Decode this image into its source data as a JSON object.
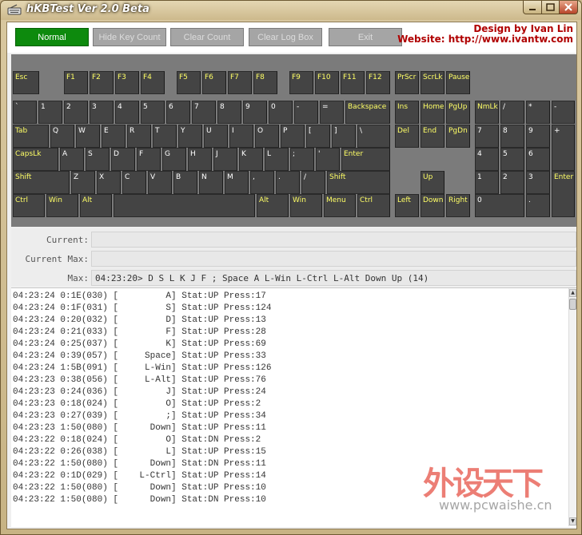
{
  "window": {
    "title": "hKBTest Ver 2.0 Beta",
    "credit_design": "Design by Ivan Lin",
    "credit_website": "Website: http://www.ivantw.com"
  },
  "toolbar": {
    "normal": "Normal",
    "hide_key_count": "Hide Key Count",
    "clear_count": "Clear Count",
    "clear_log_box": "Clear Log Box",
    "exit": "Exit"
  },
  "keyboard": {
    "esc": "Esc",
    "f1": "F1",
    "f2": "F2",
    "f3": "F3",
    "f4": "F4",
    "f5": "F5",
    "f6": "F6",
    "f7": "F7",
    "f8": "F8",
    "f9": "F9",
    "f10": "F10",
    "f11": "F11",
    "f12": "F12",
    "prscr": "PrScr",
    "scrlk": "ScrLk",
    "pause": "Pause",
    "backquote": "`",
    "k1": "1",
    "k2": "2",
    "k3": "3",
    "k4": "4",
    "k5": "5",
    "k6": "6",
    "k7": "7",
    "k8": "8",
    "k9": "9",
    "k0": "0",
    "minus": "-",
    "equal": "=",
    "backspace": "Backspace",
    "ins": "Ins",
    "home": "Home",
    "pgup": "PgUp",
    "numlk": "NmLk",
    "np_div": "/",
    "np_mul": "*",
    "np_minus": "-",
    "tab": "Tab",
    "q": "Q",
    "w": "W",
    "e": "E",
    "r": "R",
    "t": "T",
    "y": "Y",
    "u": "U",
    "i": "I",
    "o": "O",
    "p": "P",
    "lbracket": "[",
    "rbracket": "]",
    "backslash": "\\",
    "del": "Del",
    "end": "End",
    "pgdn": "PgDn",
    "np7": "7",
    "np8": "8",
    "np9": "9",
    "np_plus": "+",
    "capslk": "CapsLk",
    "a": "A",
    "s": "S",
    "d": "D",
    "f": "F",
    "g": "G",
    "h": "H",
    "j": "J",
    "k": "K",
    "l": "L",
    "semicolon": ";",
    "quote": "'",
    "enter": "Enter",
    "np4": "4",
    "np5": "5",
    "np6": "6",
    "lshift": "Shift",
    "z": "Z",
    "x": "X",
    "c": "C",
    "v": "V",
    "b": "B",
    "n": "N",
    "m": "M",
    "comma": ",",
    "period": ".",
    "slash": "/",
    "rshift": "Shift",
    "up": "Up",
    "np1": "1",
    "np2": "2",
    "np3": "3",
    "np_enter": "Enter",
    "lctrl": "Ctrl",
    "lwin": "Win",
    "lalt": "Alt",
    "space": "",
    "ralt": "Alt",
    "rwin": "Win",
    "menu": "Menu",
    "rctrl": "Ctrl",
    "left": "Left",
    "down": "Down",
    "right": "Right",
    "np0": "0",
    "np_dot": "."
  },
  "info": {
    "current_label": "Current:",
    "current_value": "",
    "current_max_label": "Current Max:",
    "current_max_value": "",
    "max_label": "Max:",
    "max_value": "04:23:20> D S L K J F ; Space A L-Win L-Ctrl L-Alt Down Up (14)"
  },
  "log": [
    {
      "time": "04:23:24",
      "code": "0:1E(030)",
      "key": "A",
      "stat": "UP",
      "press": "17"
    },
    {
      "time": "04:23:24",
      "code": "0:1F(031)",
      "key": "S",
      "stat": "UP",
      "press": "124"
    },
    {
      "time": "04:23:24",
      "code": "0:20(032)",
      "key": "D",
      "stat": "UP",
      "press": "13"
    },
    {
      "time": "04:23:24",
      "code": "0:21(033)",
      "key": "F",
      "stat": "UP",
      "press": "28"
    },
    {
      "time": "04:23:24",
      "code": "0:25(037)",
      "key": "K",
      "stat": "UP",
      "press": "69"
    },
    {
      "time": "04:23:24",
      "code": "0:39(057)",
      "key": "Space",
      "stat": "UP",
      "press": "33"
    },
    {
      "time": "04:23:24",
      "code": "1:5B(091)",
      "key": "L-Win",
      "stat": "UP",
      "press": "126"
    },
    {
      "time": "04:23:23",
      "code": "0:38(056)",
      "key": "L-Alt",
      "stat": "UP",
      "press": "76"
    },
    {
      "time": "04:23:23",
      "code": "0:24(036)",
      "key": "J",
      "stat": "UP",
      "press": "24"
    },
    {
      "time": "04:23:23",
      "code": "0:18(024)",
      "key": "O",
      "stat": "UP",
      "press": "2"
    },
    {
      "time": "04:23:23",
      "code": "0:27(039)",
      "key": ";",
      "stat": "UP",
      "press": "34"
    },
    {
      "time": "04:23:23",
      "code": "1:50(080)",
      "key": "Down",
      "stat": "UP",
      "press": "11"
    },
    {
      "time": "04:23:22",
      "code": "0:18(024)",
      "key": "O",
      "stat": "DN",
      "press": "2"
    },
    {
      "time": "04:23:22",
      "code": "0:26(038)",
      "key": "L",
      "stat": "UP",
      "press": "15"
    },
    {
      "time": "04:23:22",
      "code": "1:50(080)",
      "key": "Down",
      "stat": "DN",
      "press": "11"
    },
    {
      "time": "04:23:22",
      "code": "0:1D(029)",
      "key": "L-Ctrl",
      "stat": "UP",
      "press": "14"
    },
    {
      "time": "04:23:22",
      "code": "1:50(080)",
      "key": "Down",
      "stat": "UP",
      "press": "10"
    },
    {
      "time": "04:23:22",
      "code": "1:50(080)",
      "key": "Down",
      "stat": "DN",
      "press": "10"
    }
  ],
  "watermark": {
    "text": "外设天下",
    "url": "www.pcwaishe.cn"
  },
  "colors": {
    "normal_button": "#0d8a0d",
    "key_face": "#444444",
    "key_label": "#ffff66",
    "credit_text": "#b00000"
  }
}
